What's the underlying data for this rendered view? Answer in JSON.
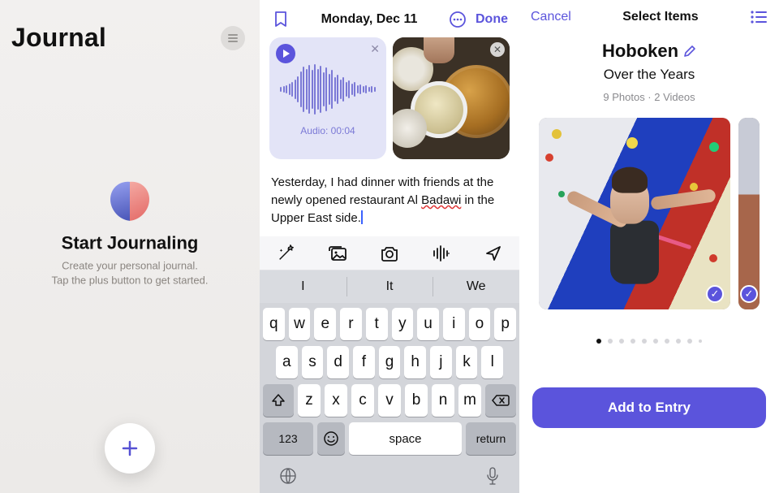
{
  "panel1": {
    "title": "Journal",
    "heading": "Start Journaling",
    "sub1": "Create your personal journal.",
    "sub2": "Tap the plus button to get started."
  },
  "panel2": {
    "date": "Monday, Dec 11",
    "done": "Done",
    "audio_label": "Audio: 00:04",
    "entry_prefix": "Yesterday, I had dinner with friends at the newly opened restaurant Al ",
    "entry_err": "Badawi",
    "entry_suffix": " in the Upper East side.",
    "suggestions": [
      "I",
      "It",
      "We"
    ],
    "keys_r1": [
      "q",
      "w",
      "e",
      "r",
      "t",
      "y",
      "u",
      "i",
      "o",
      "p"
    ],
    "keys_r2": [
      "a",
      "s",
      "d",
      "f",
      "g",
      "h",
      "j",
      "k",
      "l"
    ],
    "keys_r3": [
      "z",
      "x",
      "c",
      "v",
      "b",
      "n",
      "m"
    ],
    "key_num": "123",
    "key_space": "space",
    "key_return": "return"
  },
  "panel3": {
    "cancel": "Cancel",
    "title": "Select Items",
    "place": "Hoboken",
    "subtitle": "Over the Years",
    "meta": "9 Photos · 2 Videos",
    "button": "Add to Entry"
  }
}
